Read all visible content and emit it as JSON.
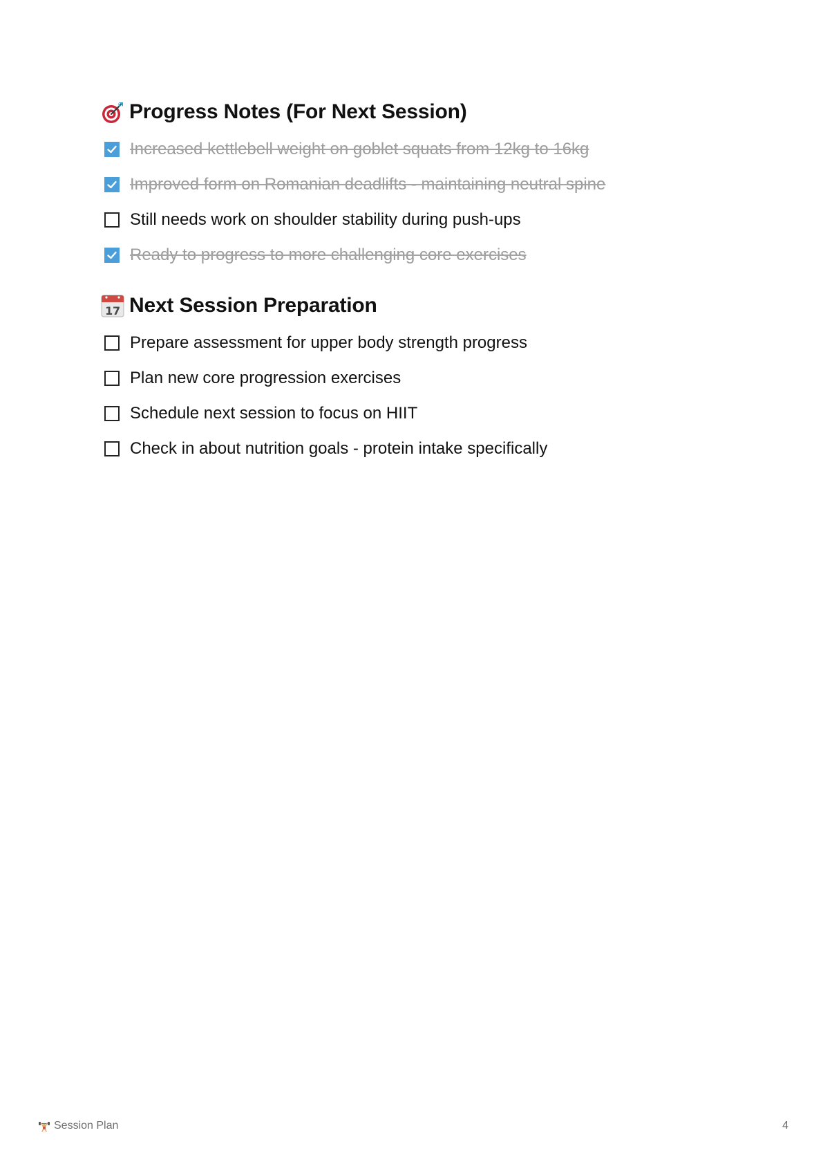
{
  "sections": [
    {
      "heading": "Progress Notes (For Next Session)",
      "icon": "target-icon",
      "items": [
        {
          "text": "Increased kettlebell weight on goblet squats from 12kg to 16kg",
          "checked": true
        },
        {
          "text": "Improved form on Romanian deadlifts - maintaining neutral spine",
          "checked": true
        },
        {
          "text": "Still needs work on shoulder stability during push-ups",
          "checked": false
        },
        {
          "text": "Ready to progress to more challenging core exercises",
          "checked": true
        }
      ]
    },
    {
      "heading": "Next Session Preparation",
      "icon": "calendar-icon",
      "calendar_day": "17",
      "items": [
        {
          "text": "Prepare assessment for upper body strength progress",
          "checked": false
        },
        {
          "text": "Plan new core progression exercises",
          "checked": false
        },
        {
          "text": "Schedule next session to focus on HIIT",
          "checked": false
        },
        {
          "text": "Check in about nutrition goals - protein intake specifically",
          "checked": false
        }
      ]
    }
  ],
  "footer": {
    "title": "Session Plan",
    "icon": "weightlifter-icon",
    "page_number": "4"
  },
  "colors": {
    "checkbox_checked": "#4a9fdb",
    "done_text": "#9b9b9b",
    "text": "#111111",
    "footer_text": "#6f6f6f"
  }
}
